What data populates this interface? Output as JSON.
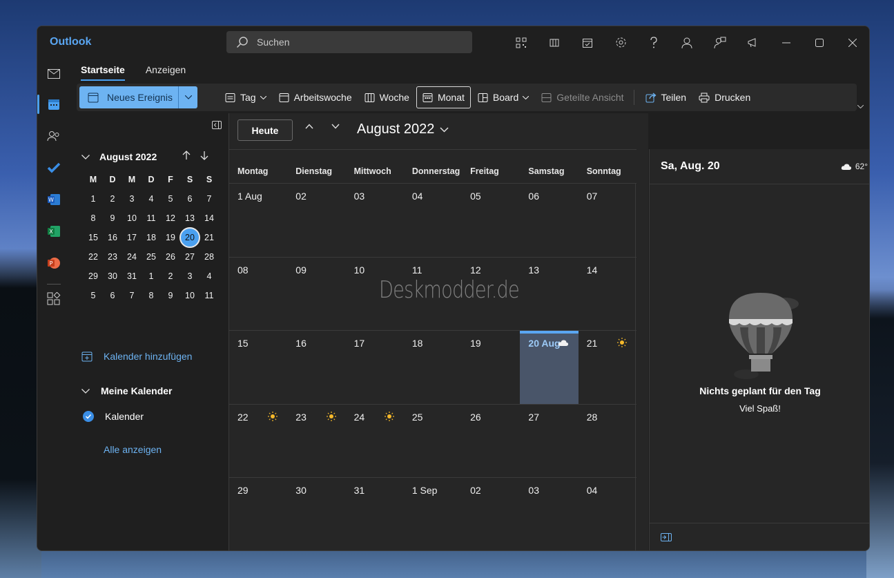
{
  "app": {
    "title": "Outlook",
    "search_placeholder": "Suchen",
    "title_icons": [
      "qr-code-icon",
      "office-icon",
      "calendar-check-icon",
      "gear-icon",
      "help-icon",
      "contacts-icon",
      "feedback-icon",
      "megaphone-icon",
      "minimize-icon",
      "maximize-icon",
      "close-icon"
    ]
  },
  "rail": {
    "items": [
      "mail-icon",
      "calendar-icon",
      "people-icon",
      "todo-icon",
      "word-icon",
      "excel-icon",
      "powerpoint-icon",
      "apps-icon"
    ],
    "active": "calendar-icon"
  },
  "ribbon": {
    "tabs": [
      {
        "label": "Startseite",
        "active": true
      },
      {
        "label": "Anzeigen",
        "active": false
      }
    ],
    "new_event": "Neues Ereignis",
    "day": "Tag",
    "work_week": "Arbeitswoche",
    "week": "Woche",
    "month": "Monat",
    "board": "Board",
    "split_view": "Geteilte Ansicht",
    "share": "Teilen",
    "print": "Drucken"
  },
  "mini_calendar": {
    "title": "August 2022",
    "weekdays": [
      "M",
      "D",
      "M",
      "D",
      "F",
      "S",
      "S"
    ],
    "days": [
      "1",
      "2",
      "3",
      "4",
      "5",
      "6",
      "7",
      "8",
      "9",
      "10",
      "11",
      "12",
      "13",
      "14",
      "15",
      "16",
      "17",
      "18",
      "19",
      "20",
      "21",
      "22",
      "23",
      "24",
      "25",
      "26",
      "27",
      "28",
      "29",
      "30",
      "31",
      "1",
      "2",
      "3",
      "4",
      "5",
      "6",
      "7",
      "8",
      "9",
      "10",
      "11"
    ],
    "today_index": 19
  },
  "left_pane": {
    "add_calendar": "Kalender hinzufügen",
    "my_calendars": "Meine Kalender",
    "calendar_name": "Kalender",
    "show_all": "Alle anzeigen"
  },
  "calendar": {
    "today_button": "Heute",
    "month_title": "August 2022",
    "weekdays": [
      "Montag",
      "Dienstag",
      "Mittwoch",
      "Donnerstag",
      "Freitag",
      "Samstag",
      "Sonntag"
    ],
    "weeks": [
      [
        {
          "d": "1 Aug"
        },
        {
          "d": "02"
        },
        {
          "d": "03"
        },
        {
          "d": "04"
        },
        {
          "d": "05"
        },
        {
          "d": "06"
        },
        {
          "d": "07"
        }
      ],
      [
        {
          "d": "08"
        },
        {
          "d": "09"
        },
        {
          "d": "10"
        },
        {
          "d": "11"
        },
        {
          "d": "12"
        },
        {
          "d": "13"
        },
        {
          "d": "14"
        }
      ],
      [
        {
          "d": "15"
        },
        {
          "d": "16"
        },
        {
          "d": "17"
        },
        {
          "d": "18"
        },
        {
          "d": "19"
        },
        {
          "d": "20 Aug",
          "sel": true,
          "wx": "cloud"
        },
        {
          "d": "21",
          "wx": "sun"
        }
      ],
      [
        {
          "d": "22",
          "wx": "sun"
        },
        {
          "d": "23",
          "wx": "sun"
        },
        {
          "d": "24",
          "wx": "sun"
        },
        {
          "d": "25"
        },
        {
          "d": "26"
        },
        {
          "d": "27"
        },
        {
          "d": "28"
        }
      ],
      [
        {
          "d": "29"
        },
        {
          "d": "30"
        },
        {
          "d": "31"
        },
        {
          "d": "1 Sep"
        },
        {
          "d": "02"
        },
        {
          "d": "03"
        },
        {
          "d": "04"
        }
      ]
    ]
  },
  "watermark": "Deskmodder.de",
  "day_pane": {
    "title": "Sa, Aug. 20",
    "temperature": "62°",
    "empty_title": "Nichts geplant für den Tag",
    "empty_sub": "Viel Spaß!"
  },
  "colors": {
    "accent": "#4aa0f0",
    "selected_day_bg": "#495569",
    "window_bg": "#1f1f1f",
    "calendar_bg": "#262626"
  }
}
